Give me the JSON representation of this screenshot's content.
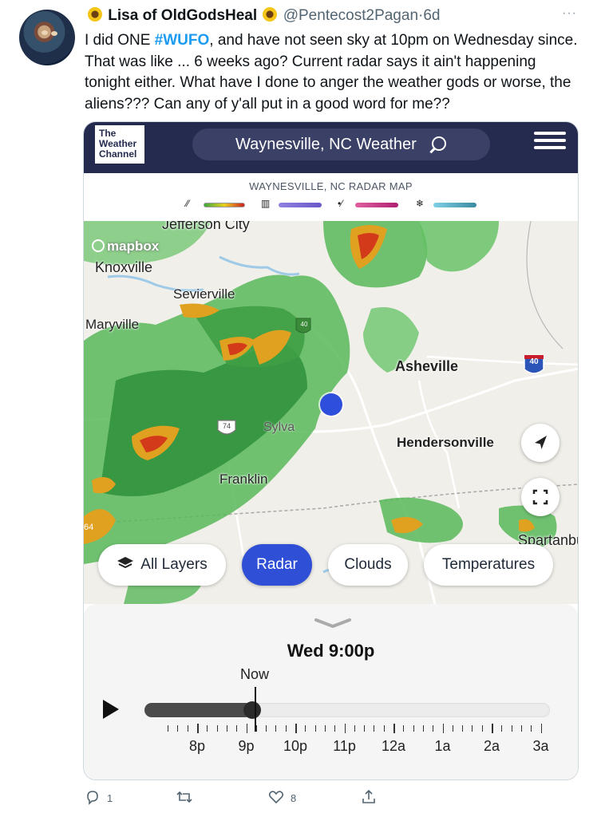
{
  "tweet": {
    "display_name": "Lisa of OldGodsHeal",
    "handle": "@Pentecost2Pagan",
    "separator": "·",
    "age": "6d",
    "more": "···",
    "text_before": "I did ONE ",
    "hashtag": "#WUFO",
    "text_after": ", and have not seen sky at 10pm on Wednesday since. That was like ... 6 weeks ago? Current radar says it ain't happening tonight either. What have I done to anger the weather gods or worse, the aliens??? Can any of y'all put in a good word for me??"
  },
  "app": {
    "logo_line1": "The",
    "logo_line2": "Weather",
    "logo_line3": "Channel",
    "search_text": "Waynesville, NC Weather",
    "radar_title": "WAYNESVILLE, NC RADAR MAP",
    "legend": [
      {
        "icon": "rain-icon",
        "symbol": "⁄⁄",
        "gradient": [
          "#3aa83a",
          "#e8d020",
          "#d02020"
        ]
      },
      {
        "icon": "mix-icon",
        "symbol": "▥",
        "gradient": [
          "#9080e0",
          "#6a58c8"
        ]
      },
      {
        "icon": "sleet-icon",
        "symbol": "•⁄",
        "gradient": [
          "#e060a0",
          "#b02070"
        ]
      },
      {
        "icon": "snow-icon",
        "symbol": "❄",
        "gradient": [
          "#80d0e8",
          "#3a8aa0"
        ]
      }
    ],
    "mapbox_label": "mapbox",
    "map_labels": [
      {
        "text": "Jefferson City",
        "name": "city-jefferson-city"
      },
      {
        "text": "Knoxville",
        "name": "city-knoxville"
      },
      {
        "text": "Sevierville",
        "name": "city-sevierville"
      },
      {
        "text": "Maryville",
        "name": "city-maryville"
      },
      {
        "text": "Asheville",
        "name": "city-asheville"
      },
      {
        "text": "Sylva",
        "name": "city-sylva"
      },
      {
        "text": "Hendersonville",
        "name": "city-hendersonville"
      },
      {
        "text": "Franklin",
        "name": "city-franklin"
      },
      {
        "text": "Spartanburg",
        "name": "city-spartanburg"
      }
    ],
    "shields": {
      "i40_a": "40",
      "i40_b": "40",
      "us74": "74",
      "i64": "64"
    },
    "layers": [
      {
        "label": "All Layers",
        "active": false
      },
      {
        "label": "Radar",
        "active": true
      },
      {
        "label": "Clouds",
        "active": false
      },
      {
        "label": "Temperatures",
        "active": false
      }
    ],
    "timeline": {
      "current_time": "Wed 9:00p",
      "now_label": "Now",
      "progress": 0.25,
      "labels": [
        "8p",
        "9p",
        "10p",
        "11p",
        "12a",
        "1a",
        "2a",
        "3a"
      ]
    },
    "colors": {
      "header_bg": "#252b4e",
      "active_layer": "#2f4fd6",
      "location_dot": "#2d4fdb"
    }
  },
  "actions": {
    "reply_count": "1",
    "retweet_count": "",
    "like_count": "8"
  }
}
